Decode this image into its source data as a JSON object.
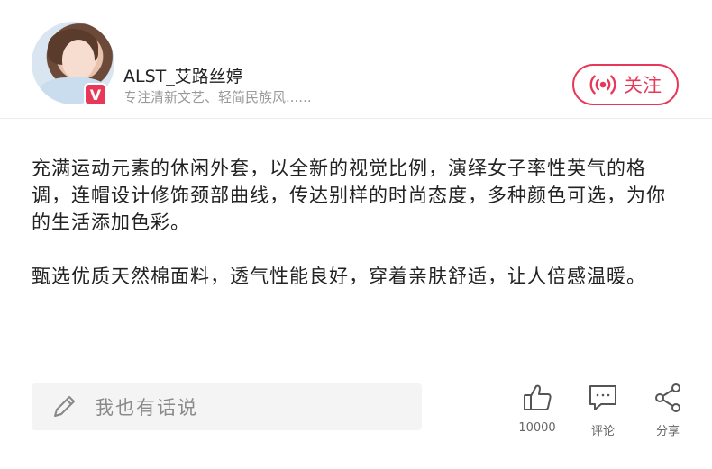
{
  "profile": {
    "name": "ALST_艾路丝婷",
    "description": "专注清新文艺、轻简民族风......",
    "badge": "V"
  },
  "follow_button": {
    "label": "关注"
  },
  "article": {
    "paragraphs": [
      "充满运动元素的休闲外套，以全新的视觉比例，演绎女子率性英气的格调，连帽设计修饰颈部曲线，传达别样的时尚态度，多种颜色可选，为你的生活添加色彩。",
      "甄选优质天然棉面料，透气性能良好，穿着亲肤舒适，让人倍感温暖。"
    ]
  },
  "footer": {
    "comment_placeholder": "我也有话说",
    "like_count": "10000",
    "comment_label": "评论",
    "share_label": "分享"
  },
  "colors": {
    "accent": "#e8385a",
    "muted_text": "#9a9a9a",
    "input_bg": "#f4f4f4"
  },
  "icons": [
    "pencil-icon",
    "thumbs-up-icon",
    "comment-icon",
    "share-icon",
    "broadcast-icon",
    "verified-badge-icon"
  ]
}
